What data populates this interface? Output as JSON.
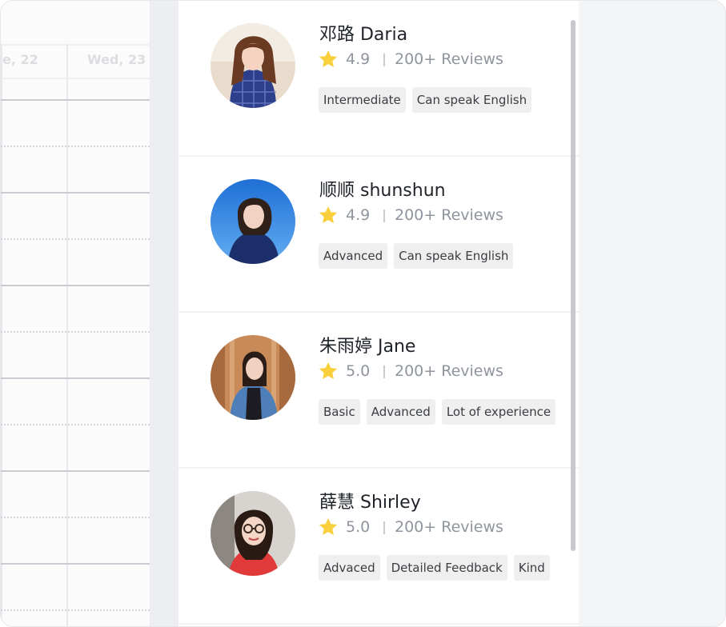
{
  "calendar": {
    "days": [
      "e, 22",
      "Wed, 23"
    ]
  },
  "teachers": [
    {
      "name": "邓路 Daria",
      "rating": "4.9",
      "reviews": "200+ Reviews",
      "tags": [
        "Intermediate",
        "Can speak English"
      ]
    },
    {
      "name": "顺顺 shunshun",
      "rating": "4.9",
      "reviews": "200+ Reviews",
      "tags": [
        "Advanced",
        "Can speak English"
      ]
    },
    {
      "name": "朱雨婷 Jane",
      "rating": "5.0",
      "reviews": "200+ Reviews",
      "tags": [
        "Basic",
        "Advanced",
        "Lot of experience"
      ]
    },
    {
      "name": "薛慧 Shirley",
      "rating": "5.0",
      "reviews": "200+ Reviews",
      "tags": [
        "Advaced",
        "Detailed Feedback",
        "Kind"
      ]
    }
  ],
  "colors": {
    "star": "#F9CF3C",
    "name": "#1F2329",
    "muted": "#8F959E",
    "tag_bg": "#EFEFEF"
  }
}
